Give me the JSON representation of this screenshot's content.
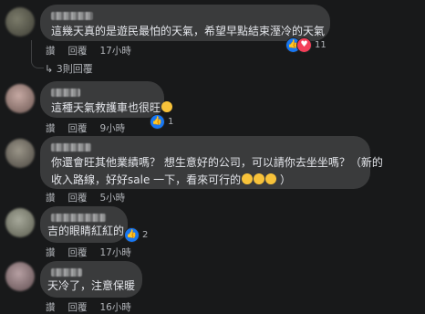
{
  "comments": [
    {
      "text": [
        "這幾天真的是遊民最怕的天氣，希望早點結束溼冷的天氣"
      ],
      "actions": {
        "like": "讚",
        "reply": "回覆",
        "time": "17小時"
      },
      "reactions": {
        "icons": [
          "like-icon",
          "heart-icon"
        ],
        "count": "11"
      },
      "replies_label": "3則回覆"
    },
    {
      "text": [
        "這種天氣救護車也很旺"
      ],
      "actions": {
        "like": "讚",
        "reply": "回覆",
        "time": "9小時"
      },
      "reactions": {
        "icons": [
          "like-icon"
        ],
        "count": "1"
      }
    },
    {
      "text": [
        "你還會旺其他業績嗎？ 想生意好的公司，可以請你去坐坐嗎？（新的",
        "收入路線，好好sale 一下，看來可行的",
        "）"
      ],
      "actions": {
        "like": "讚",
        "reply": "回覆",
        "time": "5小時"
      }
    },
    {
      "text": [
        "吉的眼睛紅紅的"
      ],
      "actions": {
        "like": "讚",
        "reply": "回覆",
        "time": "17小時"
      },
      "reactions": {
        "icons": [
          "like-icon"
        ],
        "count": "2"
      }
    },
    {
      "text": [
        "天冷了，注意保暖"
      ],
      "actions": {
        "like": "讚",
        "reply": "回覆",
        "time": "16小時"
      }
    }
  ],
  "colors": {
    "background": "#18191a",
    "bubble": "#3a3b3c",
    "like": "#1877f2",
    "heart": "#f33e58"
  }
}
